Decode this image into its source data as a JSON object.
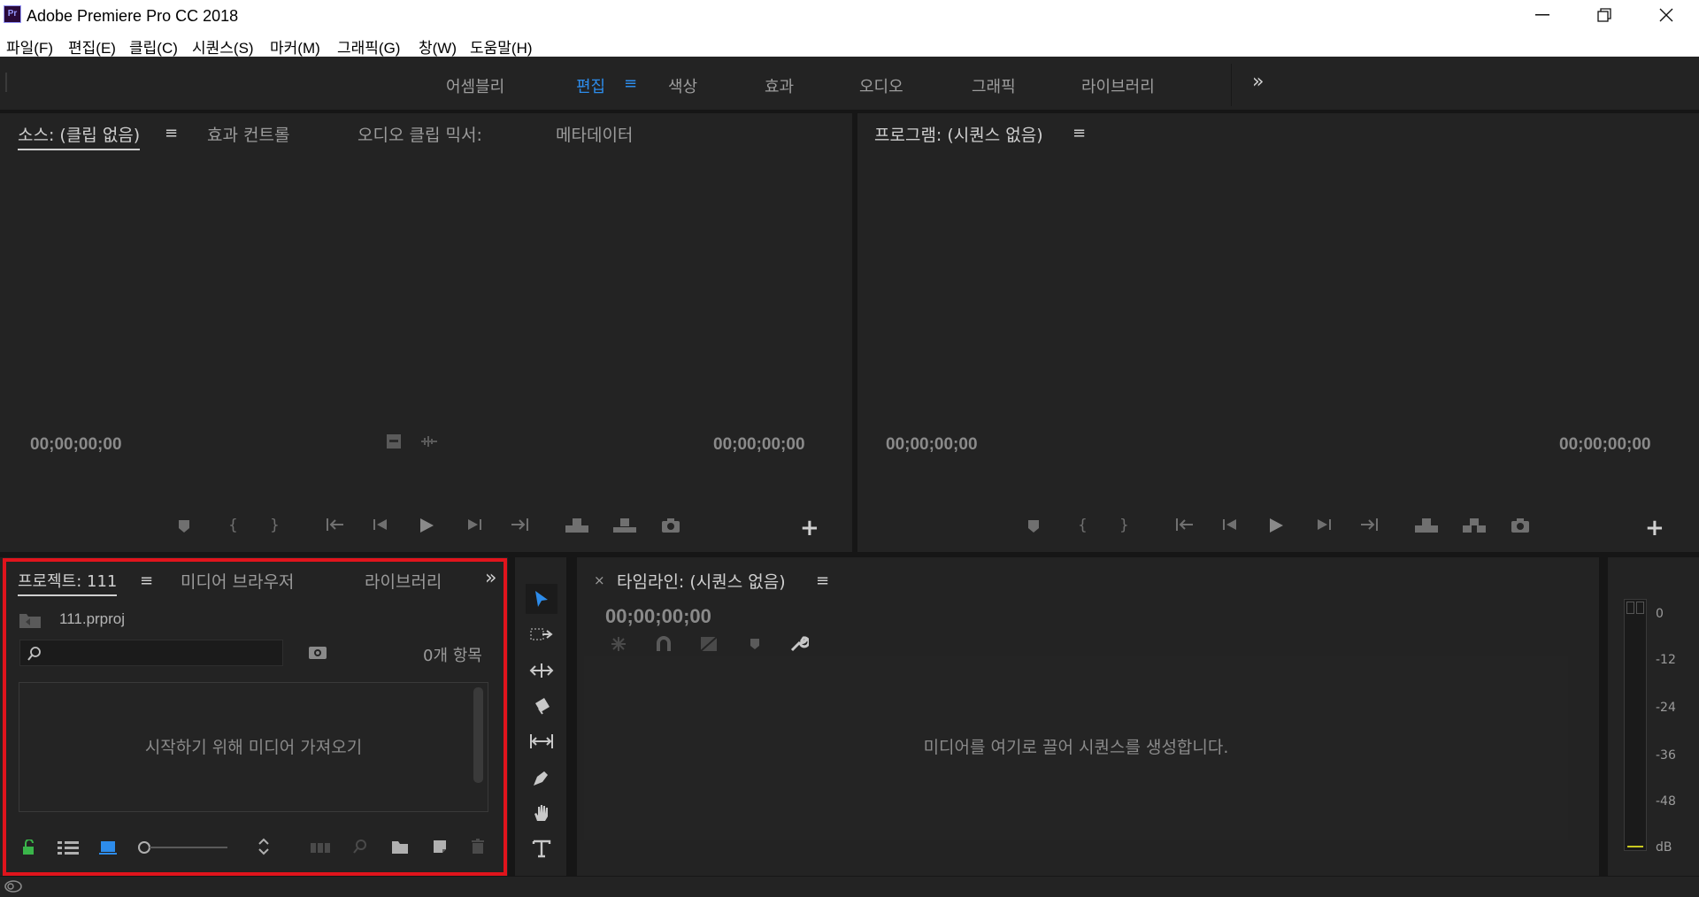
{
  "titlebar": {
    "app_icon": "Pr",
    "title": "Adobe Premiere Pro CC 2018",
    "minimize": "—",
    "restore": "❐",
    "close": "✕"
  },
  "menubar": {
    "items": [
      "파일(F)",
      "편집(E)",
      "클립(C)",
      "시퀀스(S)",
      "마커(M)",
      "그래픽(G)",
      "창(W)",
      "도움말(H)"
    ]
  },
  "workspaces": {
    "tabs": [
      "어셈블리",
      "편집",
      "색상",
      "효과",
      "오디오",
      "그래픽",
      "라이브러리"
    ],
    "active": "편집",
    "menu_icon": "≡",
    "overflow": "»"
  },
  "source_panel": {
    "tabs": [
      "소스: (클립 없음)",
      "효과 컨트롤",
      "오디오 클립 믹서:",
      "메타데이터"
    ],
    "timecode_left": "00;00;00;00",
    "timecode_right": "00;00;00;00",
    "add_button": "+"
  },
  "program_panel": {
    "tab": "프로그램: (시퀀스 없음)",
    "timecode_left": "00;00;00;00",
    "timecode_right": "00;00;00;00",
    "add_button": "+"
  },
  "project_panel": {
    "tabs": [
      "프로젝트: 111",
      "미디어 브라우저",
      "라이브러리"
    ],
    "overflow": "»",
    "project_file": "111.prproj",
    "search_placeholder": "",
    "item_count": "0개 항목",
    "empty_message": "시작하기 위해 미디어 가져오기"
  },
  "timeline_panel": {
    "close": "×",
    "tab": "타임라인: (시퀀스 없음)",
    "timecode": "00;00;00;00",
    "empty_message": "미디어를 여기로 끌어 시퀀스를 생성합니다."
  },
  "audio_meter": {
    "labels": [
      "0",
      "-12",
      "-24",
      "-36",
      "-48",
      "dB"
    ]
  },
  "colors": {
    "accent": "#2d8ceb",
    "highlight_frame": "#e0141c",
    "panel_bg": "#232323"
  }
}
